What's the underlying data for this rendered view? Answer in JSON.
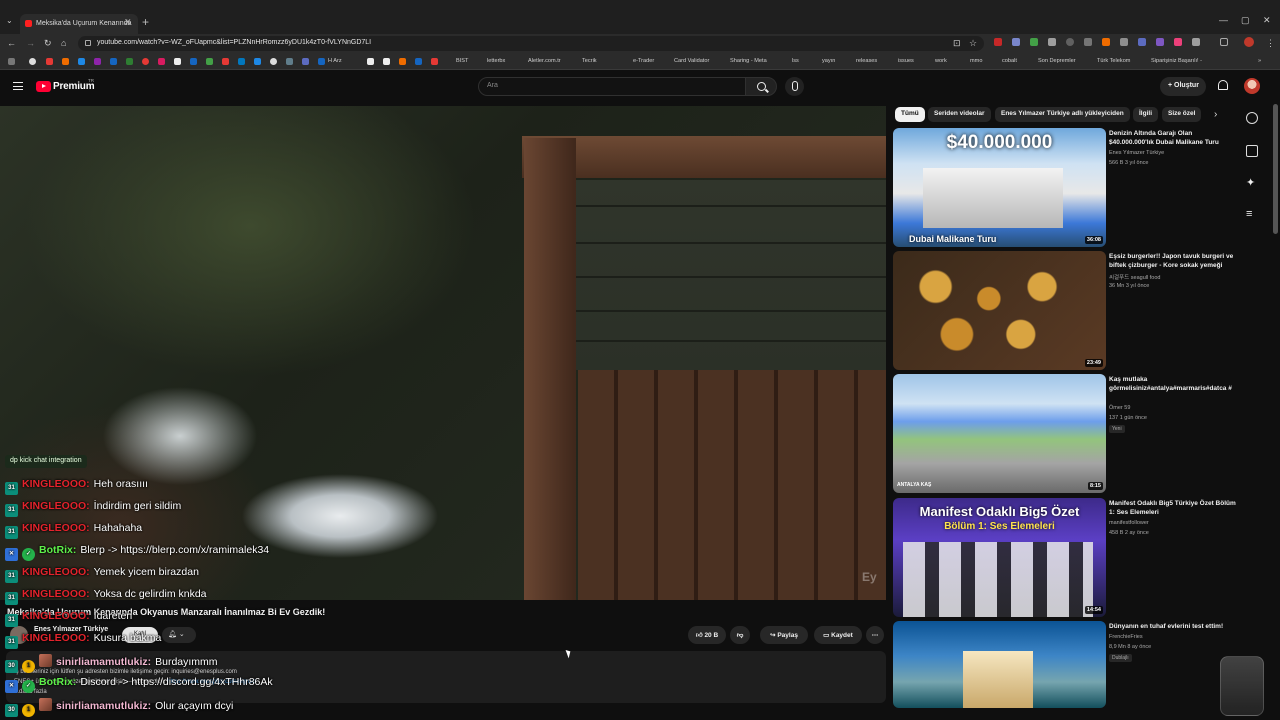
{
  "browser": {
    "tab_title": "Meksika'da Uçurum Kenarında",
    "url": "youtube.com/watch?v=-WZ_oFUapmc&list=PLZNnHrRomzz6yDU1k4zT0-fVLYNnGD7LI",
    "bookmarks": [
      "H Arz",
      "BIST",
      "letterbx",
      "Aletler.com.tr",
      "Tecrik",
      "e-Trader",
      "Card Validator",
      "Sharing - Meta",
      "lss",
      "yayın",
      "releases",
      "issues",
      "work",
      "mmo",
      "cobalt",
      "Son Depremler",
      "Türk Telekom",
      "Siparişiniz Başarılı! -"
    ]
  },
  "header": {
    "brand": "Premium",
    "brand_sup": "TR",
    "search_placeholder": "Ara",
    "create_label": "Oluştur"
  },
  "chat": {
    "tag": "dp kick chat integration",
    "messages": [
      {
        "badge": "31",
        "badge_type": "sub",
        "user": "KINGLEOOO:",
        "user_color": "red",
        "text": "Heh orasıııı"
      },
      {
        "badge": "31",
        "badge_type": "sub",
        "user": "KINGLEOOO:",
        "user_color": "red",
        "text": "İndirdim geri sildim"
      },
      {
        "badge": "31",
        "badge_type": "sub",
        "user": "KINGLEOOO:",
        "user_color": "red",
        "text": "Hahahaha"
      },
      {
        "badge": "",
        "badge_type": "bot",
        "user": "BotRix:",
        "user_color": "green",
        "text": "Blerp -> https://blerp.com/x/ramimalek34"
      },
      {
        "badge": "31",
        "badge_type": "sub",
        "user": "KINGLEOOO:",
        "user_color": "red",
        "text": "Yemek yicem birazdan"
      },
      {
        "badge": "31",
        "badge_type": "sub",
        "user": "KINGLEOOO:",
        "user_color": "red",
        "text": "Yoksa dc gelirdim knkda"
      },
      {
        "badge": "31",
        "badge_type": "sub",
        "user": "KINGLEOOO:",
        "user_color": "red",
        "text": "İdareten"
      },
      {
        "badge": "31",
        "badge_type": "sub",
        "user": "KINGLEOOO:",
        "user_color": "red",
        "text": "Kusura bakma"
      },
      {
        "badge": "30",
        "badge_type": "sub",
        "user": "sinirliamamutlukiz:",
        "user_color": "pink",
        "text": "Burdayımmm"
      },
      {
        "badge": "",
        "badge_type": "bot",
        "user": "BotRix:",
        "user_color": "green",
        "text": "Discord -> https://discord.gg/4xTHhr86Ak"
      },
      {
        "badge": "30",
        "badge_type": "sub",
        "user": "sinirliamamutlukiz:",
        "user_color": "pink",
        "text": "Olur açayım dcyi"
      }
    ]
  },
  "video": {
    "title": "Meksika'da Uçurum Kenarında Okyanus Manzaralı İnanılmaz Bi Ev Gezdik!",
    "channel": "Enes Yılmazer Türkiye",
    "join_label": "Katıl",
    "likes": "20 B",
    "share_label": "Paylaş",
    "save_label": "Kaydet",
    "desc_line1": "İş birlikleriniz için lütfen şu adresten bizimle iletişime geçin: inquiries@enesplus.com",
    "desc_line2_prefix": "ENES+ üyesi olun ve özel içeriklere erişin — abone olun:",
    "desc_link": "https://www.enesplus.com/signup",
    "desc_more": "...daha fazla"
  },
  "chips": [
    "Tümü",
    "Seriden videolar",
    "Enes Yılmazer Türkiye adlı yükleyiciden",
    "İlgili",
    "Size özel"
  ],
  "recommendations": [
    {
      "title": "Denizin Altında Garajı Olan $40.000.000'lık Dubai Malikane Turu",
      "channel": "Enes Yılmazer Türkiye",
      "meta": "566 B  3 yıl önce",
      "duration": "36:08",
      "thumb_text": "$40.000.000",
      "thumb_caption": "Dubai Malikane Turu"
    },
    {
      "title": "Eşsiz burgerler!! Japon tavuk burgeri ve biftek çizburger - Kore sokak yemeği",
      "channel": "씨걸푸드 seagull food",
      "meta": "36 Mn  3 yıl önce",
      "duration": "23:49"
    },
    {
      "title": "Kaş mutlaka görmelisiniz#antalya#marmaris#datca #",
      "channel": "Ömer 59",
      "meta": "137  1 gün önce",
      "duration": "8:15",
      "badge": "Yeni",
      "thumb_caption": "ANTALYA KAŞ"
    },
    {
      "title": "Manifest Odaklı Big5 Türkiye Özet Bölüm 1: Ses Elemeleri",
      "channel": "manifestfollower",
      "meta": "458 B  2 ay önce",
      "duration": "14:54",
      "thumb_text": "Manifest Odaklı Big5 Özet",
      "thumb_caption": "Bölüm 1: Ses Elemeleri"
    },
    {
      "title": "Dünyanın en tuhaf evlerini test ettim!",
      "channel": "FrenchieFries",
      "meta": "8,9 Mn  8 ay önce",
      "badge": "Dublajlı"
    }
  ],
  "colors": {
    "youtube_red": "#ff0033",
    "kick_green": "#53fc18",
    "user_red": "#e3232c",
    "link_blue": "#3ea6ff"
  }
}
